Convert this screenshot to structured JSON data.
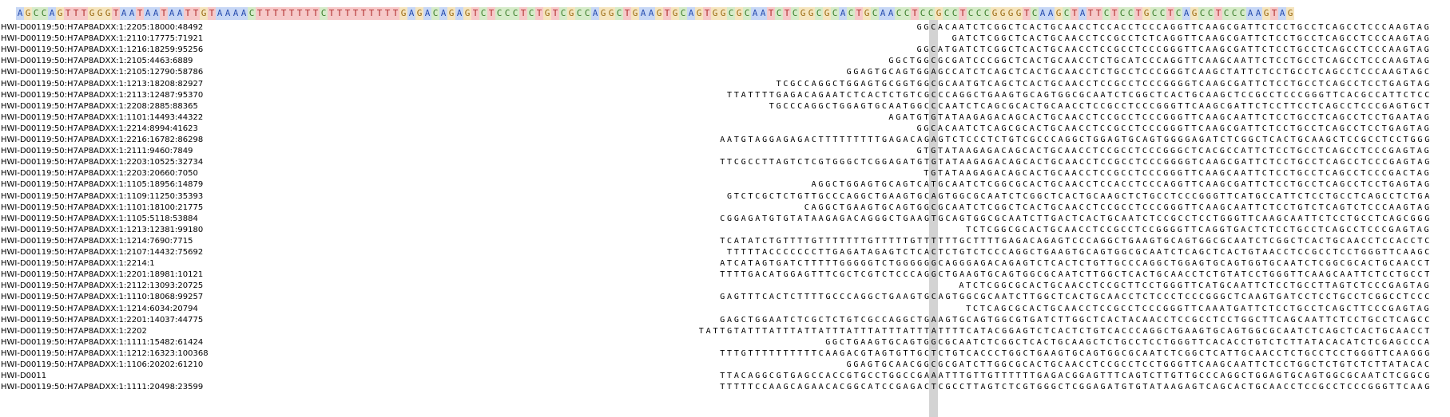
{
  "reference": {
    "sequence": "AGCCAGTTTGGGTAATAATAATTGTAAAACTTTTTTTTCTTTTTTTTTGAGACAGAGTCTCCCTCTGTCGCCAGGCTGAAGTGCAGTGGCGCAATCTCGGCGCACTGCAACCTCCGCCTCCCGGGGTCAAGCTATTCTCCTGCCTCAGCCTCCCAAGTAG"
  },
  "reads": [
    {
      "name": "HWI-D00119:50:H7AP8ADXX:1:2205:18000:48492",
      "seq": "GGCACAATCTCGGCTCACTGCAACCTCCACCTCCCAGGTTCAAGCGATTCTCCTGCCTCAGCCTCCCAAGTAG"
    },
    {
      "name": "HWI-D00119:50:H7AP8ADXX:1:2110:17775:71921",
      "seq": "GATCTCGGCTCACTGCAACCTCCGCCTCTCAGGTTCAAGCGATTCTCCTGCCTCAGCCTCCCAAGTAG"
    },
    {
      "name": "HWI-D00119:50:H7AP8ADXX:1:1216:18259:95256",
      "seq": "GGCATGATCTCGGCTCACTGCAACCTCCGCCTCCCGGGTTCAAGCGATTCTCCTGCCTCAGCCTCCCAAGTAG"
    },
    {
      "name": "HWI-D00119:50:H7AP8ADXX:1:2105:4463:6889",
      "seq": "GGCTGGCGCGATCCCGGCTCACTGCAACCTCTGCATCCCAGGTTCAAGCAATTCTCCTGCCTCAGCCTCCCAAGTAG"
    },
    {
      "name": "HWI-D00119:50:H7AP8ADXX:1:2105:12790:58786",
      "seq": "GGAGTGCAGTGGAGCCATCTCAGCTCACTGCAACCTCTGCCTCCCGGGTCAAGCTATTCTCCTGCCTCAGCCTCCCAAGTAGC"
    },
    {
      "name": "HWI-D00119:50:H7AP8ADXX:1:1213:18208:82927",
      "seq": "TCGCCAGGCTGGAGTGCGGTGGCGCAATGTCAGCTCACTGCAACCTCCGCCTCCCGGGGTCAAGCGATTCTCCTGCCTCAGCCTCCTGAGTAG"
    },
    {
      "name": "HWI-D00119:50:H7AP8ADXX:1:2113:12487:95370",
      "seq": "TTATTTTGAGACAGAATCTCACTCTGTCGCCCAGGCTGAAGTGCAGTGGCGCAATCTCGGCTCACTGCAAGCTCCGCCTCCCGGGTTCACGCCATTCTCC"
    },
    {
      "name": "HWI-D00119:50:H7AP8ADXX:1:2208:2885:88365",
      "seq": "TGCCCAGGCTGGAGTGCAATGGCCCAATCTCAGCGCACTGCAACCTCCGCCTCCCGGGTTCAAGCGATTCTCCTTCCTCAGCCTCCCGAGTGCT"
    },
    {
      "name": "HWI-D00119:50:H7AP8ADXX:1:1101:14493:44322",
      "seq": "AGATGTGTATAAGAGACAGCACTGCAACCTCCGCCTCCCGGGTTCAAGCAATTCTCCTGCCTCAGCCTCCTGAATAG"
    },
    {
      "name": "HWI-D00119:50:H7AP8ADXX:1:2214:8994:41623",
      "seq": "GGCACAATCTCAGCGCACTGCAACCTCCGCCTCCCGGGTTCAAGCGATTCTCCTGCCTCAGCCTCCTGAGTAG"
    },
    {
      "name": "HWI-D00119:50:H7AP8ADXX:1:2216:16782:86298",
      "seq": "AATGTAGGAGAGACTTTTTTTTTGAGACAGAGTCTCCCTCTGTCGCCCAGGCTGGAGTGCAGTGGGGAGATCTCGGCTCACTGCAAGCTCCGCCTCCTGGG"
    },
    {
      "name": "HWI-D00119:50:H7AP8ADXX:1:2111:9460:7849",
      "seq": "GTGTATAAGAGACAGCACTGCAACCTCCGCCTCCCGGGCTCACGCCATTCTCCTGCCTCAGCCTCCCGAGTAG"
    },
    {
      "name": "HWI-D00119:50:H7AP8ADXX:1:2203:10525:32734",
      "seq": "TTCGCCTTAGTCTCGTGGGCTCGGAGATGTGTATAAGAGACAGCACTGCAACCTCCGCCTCCCGGGGTCAAGCGATTCTCCTGCCTCAGCCTCCCGAGTAG"
    },
    {
      "name": "HWI-D00119:50:H7AP8ADXX:1:2203:20660:7050",
      "seq": "TGTATAAGAGACAGCACTGCAACCTCCGCCTCCCGGGTTCAAGCAATTCTCCTGCCTCAGCCTCCCGACTAG"
    },
    {
      "name": "HWI-D00119:50:H7AP8ADXX:1:1105:18956:14879",
      "seq": "AGGCTGGAGTGCAGTCATGCAATCTCGGCGCACTGCAACCTCCACCTCCCAGGTTCAAGCGATTCTCCTGCCTCAGCCTCCTGAGTAG"
    },
    {
      "name": "HWI-D00119:50:H7AP8ADXX:1:1109:11250:35393",
      "seq": "GTCTCGCTCTGTTGCCCAGGCTGAAGTGCAGTGGCGCAATCTCGGCTCACTGCAAGCTCTGCCTCCCGGGTTCATGCCATTCTCCTGCCTCAGCCTCTGA"
    },
    {
      "name": "HWI-D00119:50:H7AP8ADXX:1:1101:18100:21775",
      "seq": "CAGGCTGAAGTGCAGTGGCGCAATCTCGGCTCACTGCAACCTCCGCCTCCCGGGTTCAAGCAATTCTCCTGTCTCAGTCTCCCAAGTAG"
    },
    {
      "name": "HWI-D00119:50:H7AP8ADXX:1:1105:5118:53884",
      "seq": "CGGAGATGTGTATAAGAGACAGGGCTGAAGTGCAGTGGCGCAATCTTGACTCACTGCAATCTCCGCCTCCTGGGTTCAAGCAATTCTCCTGCCTCAGCGGG"
    },
    {
      "name": "HWI-D00119:50:H7AP8ADXX:1:1213:12381:99180",
      "seq": "TCTCGGCGCACTGCAACCTCCGCCTCCGGGGTTCAGGTGACTCTCCTGCCTCAGCCTCCCGAGTAG"
    },
    {
      "name": "HWI-D00119:50:H7AP8ADXX:1:1214:7690:7715",
      "seq": "TCATATCTGTTTTGTTTTTTTGTTTTTGTTTTTTGCTTTTGAGACAGAGTCCCAGGCTGAAGTGCAGTGGCGCAATCTCGGCTCACTGCAACCTCCACCTC"
    },
    {
      "name": "HWI-D00119:50:H7AP8ADXX:1:2107:14432:75692",
      "seq": "TTTTTACCCCCCCTTGAGATAGAGTCTCACTCTGTCTCCCAGGCTGAAGTGCAGTGGCGCAATCTCAGCTCACTGTAACCTCCGCCTCCTGGGTTCAAGC"
    },
    {
      "name": "HWI-D00119:50:H7AP8ADXX:1:2214:1",
      "seq": "ATCATAGTGATCTTTTTGGGGGTCTGGGGGGCAGGGAGACAGAGTCTCACTCTGTTGCCCAGGCTGGAGTGCAGTGGTGCAATCTCGGCGCACTGCAACCT"
    },
    {
      "name": "HWI-D00119:50:H7AP8ADXX:1:2201:18981:10121",
      "seq": "TTTTGACATGGAGTTTCGCTCGTCTCCCAGGCTGAAGTGCAGTGGCGCAATCTTGGCTCACTGCAACCTCTGTATCCTGGGTTCAAGCAATTCTCCTGCCT"
    },
    {
      "name": "HWI-D00119:50:H7AP8ADXX:1:2112:13093:20725",
      "seq": "ATCTCGGCGCACTGCAACCTCCGCTTCCTGGGTTCATGCAATTCTCCTGCCTTAGTCTCCCGAGTAG"
    },
    {
      "name": "HWI-D00119:50:H7AP8ADXX:1:1110:18068:99257",
      "seq": "GAGTTTCACTCTTTTGCCCAGGCTGAAGTGCAGTGGCGCAATCTTGGCTCACTGCAACCTCTCCCTCCCGGGCTCAAGTGATCCTCCTGCCTCGGCCTCCC"
    },
    {
      "name": "HWI-D00119:50:H7AP8ADXX:1:1214:6034:20794",
      "seq": "TCTCAGCGCACTGCAACCTCCGCCTCCCGGGTTCAAATGATTCTCCTGCCTCAGCTTCCCGAGTAG"
    },
    {
      "name": "HWI-D00119:50:H7AP8ADXX:1:2201:14037:44775",
      "seq": "GAGCTGGAATCTCGCTCTGTCGCCAGGCTGAAGTGCAGTGGCGTGATCTTGGCTCACTACAACCTCCGCCTCCTGGCTTCAGCAATTCTCCTGCCTCAGCC"
    },
    {
      "name": "HWI-D00119:50:H7AP8ADXX:1:2202",
      "seq": "TATTGTATTTATTTATTATTTATTTATTTATTTATTTTCATACGGAGTCTCACTCTGTCACCCAGGCTGAAGTGCAGTGGCGCAATCTCAGCTCACTGCAACCT"
    },
    {
      "name": "HWI-D00119:50:H7AP8ADXX:1:1111:15482:61424",
      "seq": "GGCTGAAGTGCAGTGGCGCAATCTCGGCTCACTGCAAGCTCTGCCTCCTGGGTTCACACCTGTCTCTTATACACATCTCGAGCCCA"
    },
    {
      "name": "HWI-D00119:50:H7AP8ADXX:1:1212:16323:100368",
      "seq": "TTTGTTTTTTTTTTCAAGACGTAGTGTTGCTCTGTCACCCTGGCTGAAGTGCAGTGGCGCAATCTCGGCTCATTGCAACCTCTGCCTCCTGGGTTCAAGGG"
    },
    {
      "name": "HWI-D00119:50:H7AP8ADXX:1:1106:20202:61210",
      "seq": "GGAGTGCAACGGCGCGATCTTGGCGCACTGCAACCTCCGCCTCCTGGGTTCAAGCAATTCTCCTGGCTCTGTCTCTTATACAC"
    },
    {
      "name": "HWI-D0011",
      "seq": "TTACAGGCGTGAGCCACCGTGCCTGGCCGAAATTTGTTGTTTTTTGAGACGGAGTTTCAGTCTTGTTGCCCAGGCTGGAGTGCAGTGGCGCAATCTCGGCG"
    },
    {
      "name": "HWI-D00119:50:H7AP8ADXX:1:1111:20498:23599",
      "seq": "TTTTTCCAAGCAGAACACGGCATCCGAGACTCGCCTTAGTCTCGTGGGCTCGGAGATGTGTATAAGAGTCAGCACTGCAACCTCCGCCTCCCGGGTTCAAG"
    }
  ]
}
